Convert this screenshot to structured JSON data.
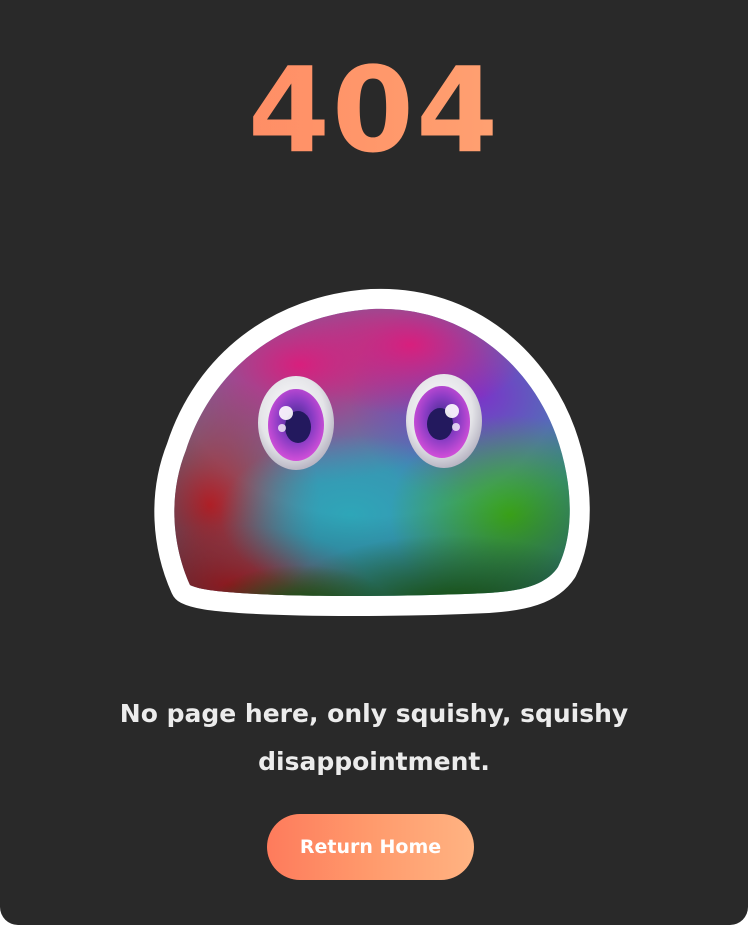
{
  "error": {
    "code": "404",
    "message": "No page here, only squishy, squishy disappointment."
  },
  "actions": {
    "return_home_label": "Return Home"
  },
  "illustration": {
    "icon": "rainbow-blob-icon"
  },
  "colors": {
    "background": "#292929",
    "accent_start": "#fe7b5c",
    "accent_end": "#ffb382",
    "text": "#ececec"
  }
}
